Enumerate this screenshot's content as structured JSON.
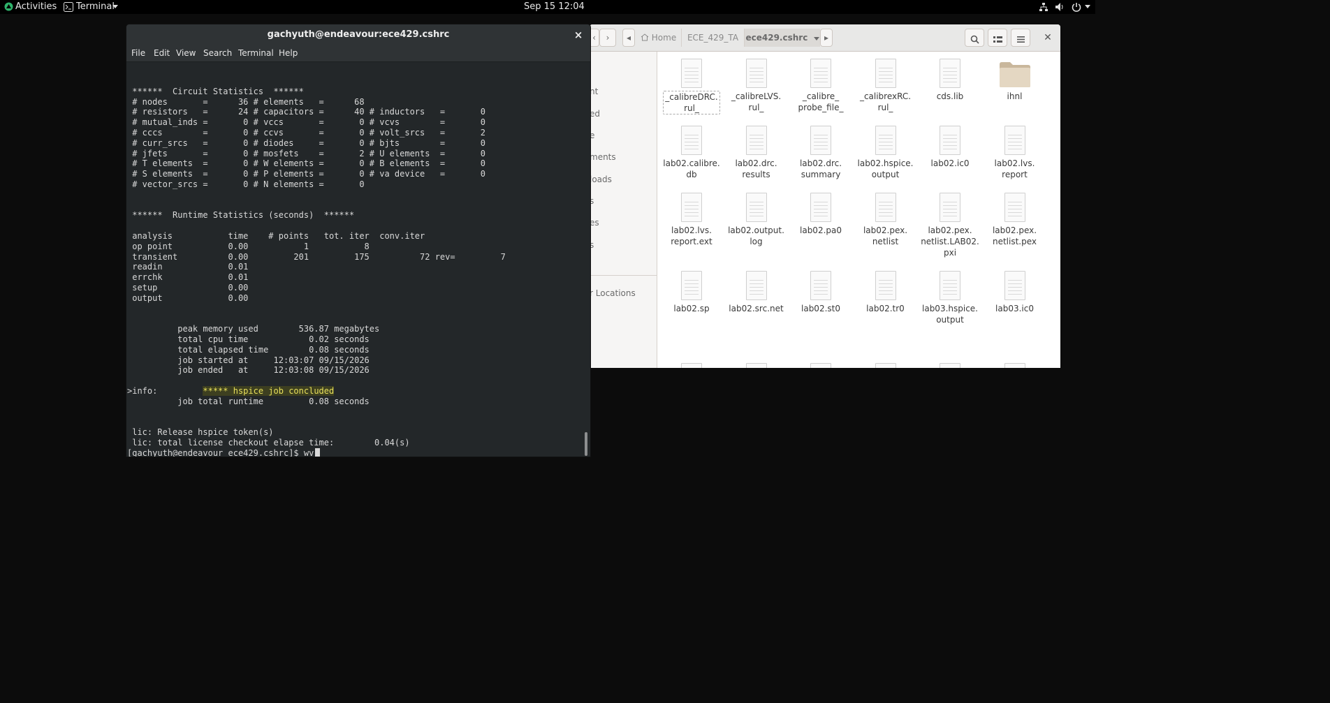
{
  "topbar": {
    "activities": "Activities",
    "app_name": "Terminal",
    "datetime": "Sep 15  12:04"
  },
  "terminal": {
    "title": "gachyuth@endeavour:ece429.cshrc",
    "close": "×",
    "menu": [
      "File",
      "Edit",
      "View",
      "Search",
      "Terminal",
      "Help"
    ],
    "lines": [
      "",
      " ******  Circuit Statistics  ******",
      " # nodes       =      36 # elements   =      68",
      " # resistors   =      24 # capacitors =      40 # inductors   =       0",
      " # mutual_inds =       0 # vccs       =       0 # vcvs        =       0",
      " # cccs        =       0 # ccvs       =       0 # volt_srcs   =       2",
      " # curr_srcs   =       0 # diodes     =       0 # bjts        =       0",
      " # jfets       =       0 # mosfets    =       2 # U elements  =       0",
      " # T elements  =       0 # W elements =       0 # B elements  =       0",
      " # S elements  =       0 # P elements =       0 # va device   =       0",
      " # vector_srcs =       0 # N elements =       0",
      "",
      "",
      " ******  Runtime Statistics (seconds)  ******",
      "",
      " analysis           time    # points   tot. iter  conv.iter",
      " op point           0.00           1           8",
      " transient          0.00         201         175          72 rev=         7",
      " readin             0.01",
      " errchk             0.01",
      " setup              0.00",
      " output             0.00",
      "",
      "",
      "          peak memory used        536.87 megabytes",
      "          total cpu time            0.02 seconds",
      "          total elapsed time        0.08 seconds",
      "          job started at     12:03:07 09/15/2026",
      "          job ended   at     12:03:08 09/15/2026",
      "",
      ">info:         ",
      "          job total runtime         0.08 seconds",
      "",
      "",
      " lic: Release hspice token(s)",
      " lic: total license checkout elapse time:        0.04(s)",
      "[gachyuth@endeavour ece429.cshrc]$ wv"
    ],
    "info_highlight": "***** hspice job concluded"
  },
  "files": {
    "breadcrumbs": [
      "Home",
      "ECE_429_TA",
      "ece429.cshrc"
    ],
    "sidebar_fragments": [
      "nt",
      "ed",
      "e",
      "ments",
      "loads",
      "s",
      "es",
      "s",
      "r Locations"
    ],
    "items": [
      {
        "name": "_calibreDRC.\nrul_",
        "kind": "doc",
        "selected": true
      },
      {
        "name": "_calibreLVS.\nrul_",
        "kind": "doc"
      },
      {
        "name": "_calibre_\nprobe_file_",
        "kind": "doc"
      },
      {
        "name": "_calibrexRC.\nrul_",
        "kind": "doc"
      },
      {
        "name": "cds.lib",
        "kind": "doc"
      },
      {
        "name": "ihnl",
        "kind": "folder"
      },
      {
        "name": "lab02.calibre.\ndb",
        "kind": "doc"
      },
      {
        "name": "lab02.drc.\nresults",
        "kind": "doc"
      },
      {
        "name": "lab02.drc.\nsummary",
        "kind": "doc"
      },
      {
        "name": "lab02.hspice.\noutput",
        "kind": "doc"
      },
      {
        "name": "lab02.ic0",
        "kind": "doc"
      },
      {
        "name": "lab02.lvs.\nreport",
        "kind": "doc"
      },
      {
        "name": "lab02.lvs.\nreport.ext",
        "kind": "doc"
      },
      {
        "name": "lab02.output.\nlog",
        "kind": "doc"
      },
      {
        "name": "lab02.pa0",
        "kind": "doc"
      },
      {
        "name": "lab02.pex.\nnetlist",
        "kind": "doc"
      },
      {
        "name": "lab02.pex.\nnetlist.LAB02.\npxi",
        "kind": "doc"
      },
      {
        "name": "lab02.pex.\nnetlist.pex",
        "kind": "doc"
      },
      {
        "name": "lab02.sp",
        "kind": "doc"
      },
      {
        "name": "lab02.src.net",
        "kind": "doc"
      },
      {
        "name": "lab02.st0",
        "kind": "doc"
      },
      {
        "name": "lab02.tr0",
        "kind": "doc"
      },
      {
        "name": "lab03.hspice.\noutput",
        "kind": "doc"
      },
      {
        "name": "lab03.ic0",
        "kind": "doc"
      }
    ]
  }
}
